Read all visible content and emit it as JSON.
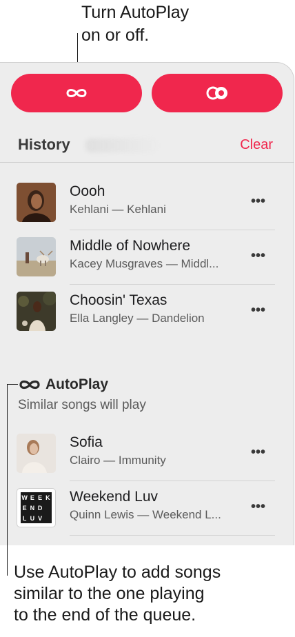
{
  "callouts": {
    "top_line1": "Turn AutoPlay",
    "top_line2": "on or off.",
    "bottom_line1": "Use AutoPlay to add songs",
    "bottom_line2": "similar to the one playing",
    "bottom_line3": "to the end of the queue."
  },
  "buttons": {
    "autoplay_icon": "infinity-icon",
    "shuffle_icon": "circles-toggle-icon",
    "accent": "#f0274d"
  },
  "history": {
    "title": "History",
    "clear_label": "Clear",
    "items": [
      {
        "title": "Oooh",
        "subtitle": "Kehlani — Kehlani",
        "more": "•••"
      },
      {
        "title": "Middle of Nowhere",
        "subtitle": "Kacey Musgraves — Middl...",
        "more": "•••"
      },
      {
        "title": "Choosin' Texas",
        "subtitle": "Ella Langley — Dandelion",
        "more": "•••"
      }
    ]
  },
  "autoplay": {
    "title": "AutoPlay",
    "subtitle": "Similar songs will play",
    "items": [
      {
        "title": "Sofia",
        "subtitle": "Clairo — Immunity",
        "more": "•••"
      },
      {
        "title": "Weekend Luv",
        "subtitle": "Quinn Lewis — Weekend L...",
        "more": "•••",
        "art_text": [
          "W",
          "E",
          "E",
          "K",
          "E",
          "N",
          "D",
          "L",
          "U",
          "V"
        ]
      }
    ]
  }
}
